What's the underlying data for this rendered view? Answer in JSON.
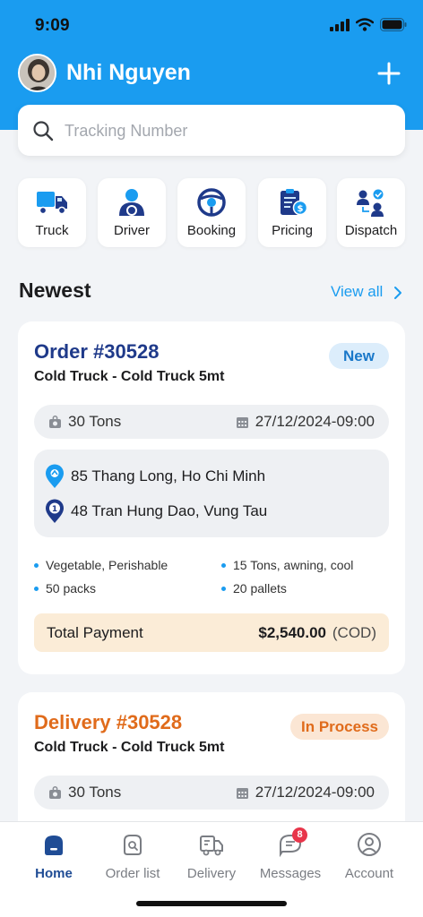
{
  "status_bar": {
    "time": "9:09"
  },
  "header": {
    "user_name": "Nhi Nguyen"
  },
  "search": {
    "placeholder": "Tracking Number"
  },
  "quick_actions": [
    {
      "label": "Truck",
      "icon": "truck-icon"
    },
    {
      "label": "Driver",
      "icon": "driver-icon"
    },
    {
      "label": "Booking",
      "icon": "steering-wheel-icon"
    },
    {
      "label": "Pricing",
      "icon": "pricing-clipboard-icon"
    },
    {
      "label": "Dispatch",
      "icon": "dispatch-people-icon"
    }
  ],
  "section": {
    "title": "Newest",
    "view_all": "View all"
  },
  "orders": [
    {
      "title": "Order #30528",
      "title_color": "#1f3a8a",
      "subtitle": "Cold Truck - Cold Truck 5mt",
      "badge": "New",
      "badge_color": "#1a78c9",
      "badge_bg": "#dcedfb",
      "weight": "30 Tons",
      "datetime": "27/12/2024-09:00",
      "pickup": "85 Thang Long, Ho Chi Minh",
      "dropoff": "48 Tran Hung Dao, Vung Tau",
      "specs": [
        "Vegetable, Perishable",
        "15 Tons, awning, cool",
        "50 packs",
        "20 pallets"
      ],
      "payment_label": "Total Payment",
      "payment_amount": "$2,540.00",
      "payment_method": "(COD)"
    },
    {
      "title": "Delivery #30528",
      "title_color": "#e06b1b",
      "subtitle": "Cold Truck - Cold Truck 5mt",
      "badge": "In Process",
      "badge_color": "#e06b1b",
      "badge_bg": "#fbe6d4",
      "weight": "30 Tons",
      "datetime": "27/12/2024-09:00"
    }
  ],
  "tabs": [
    {
      "label": "Home",
      "icon": "home-icon",
      "active": true
    },
    {
      "label": "Order list",
      "icon": "order-list-icon"
    },
    {
      "label": "Delivery",
      "icon": "delivery-truck-icon"
    },
    {
      "label": "Messages",
      "icon": "messages-icon",
      "badge": "8"
    },
    {
      "label": "Account",
      "icon": "account-icon"
    }
  ],
  "colors": {
    "primary": "#1a9cf0",
    "navy": "#1f3a8a",
    "orange": "#e06b1b"
  }
}
